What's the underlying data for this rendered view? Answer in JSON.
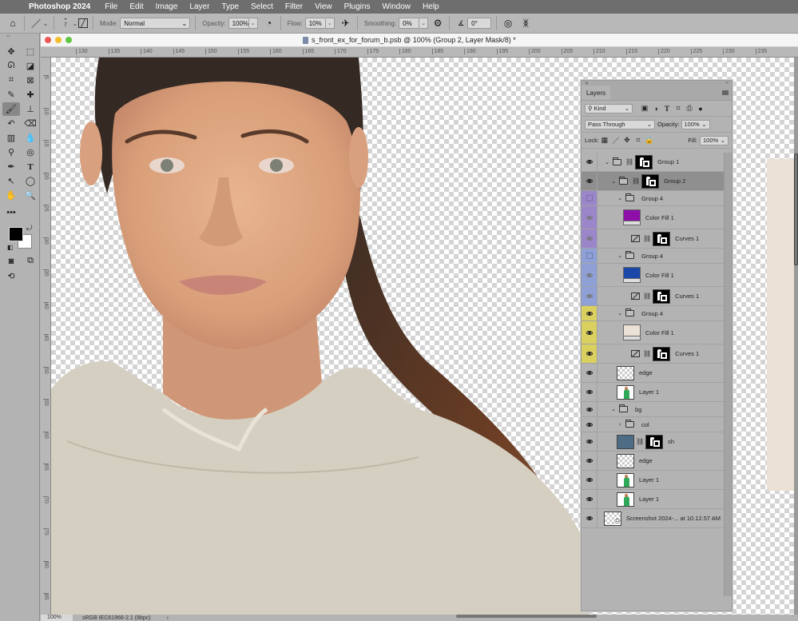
{
  "menubar": {
    "app_name": "Photoshop 2024",
    "items": [
      "File",
      "Edit",
      "Image",
      "Layer",
      "Type",
      "Select",
      "Filter",
      "View",
      "Plugins",
      "Window",
      "Help"
    ]
  },
  "options_bar": {
    "brush_size": "7",
    "mode_label": "Mode:",
    "mode_value": "Normal",
    "opacity_label": "Opacity:",
    "opacity_value": "100%",
    "flow_label": "Flow:",
    "flow_value": "10%",
    "smoothing_label": "Smoothing:",
    "smoothing_value": "0%",
    "angle_value": "0°"
  },
  "document": {
    "title": "s_front_ex_for_forum_b.psb @ 100% (Group 2, Layer Mask/8) *",
    "zoom": "100%",
    "color_profile": "sRGB IEC61966-2.1 (8bpc)",
    "status_arrow": "›",
    "ruler_h": [
      "130",
      "135",
      "140",
      "145",
      "150",
      "155",
      "160",
      "165",
      "170",
      "175",
      "180",
      "185",
      "190",
      "195",
      "200",
      "205",
      "210",
      "215",
      "220",
      "225",
      "230",
      "235"
    ],
    "ruler_v": [
      "5",
      "10",
      "15",
      "20",
      "25",
      "30",
      "35",
      "40",
      "45",
      "50",
      "55",
      "60",
      "65",
      "70",
      "75",
      "80",
      "85"
    ]
  },
  "layers_panel": {
    "title": "Layers",
    "filter_kind": "Kind",
    "blend_mode": "Pass Through",
    "opacity_label": "Opacity:",
    "opacity_value": "100%",
    "lock_label": "Lock:",
    "fill_label": "Fill:",
    "fill_value": "100%",
    "layers": [
      {
        "name": "Group 1",
        "type": "group",
        "indent": 0,
        "expanded": true,
        "visible": true,
        "color": "none",
        "selected": false,
        "mask": true
      },
      {
        "name": "Group 2",
        "type": "group",
        "indent": 1,
        "expanded": true,
        "visible": true,
        "color": "none",
        "selected": true,
        "mask": true
      },
      {
        "name": "Group 4",
        "type": "group",
        "indent": 2,
        "expanded": true,
        "visible": false,
        "color": "purple",
        "selected": false,
        "mask": false
      },
      {
        "name": "Color Fill 1",
        "type": "fill",
        "indent": 3,
        "visible": true,
        "color": "purple",
        "fill_color": "#8e0fa8"
      },
      {
        "name": "Curves 1",
        "type": "curves",
        "indent": 3,
        "visible": true,
        "color": "purple"
      },
      {
        "name": "Group 4",
        "type": "group",
        "indent": 2,
        "expanded": true,
        "visible": false,
        "color": "blue",
        "selected": false,
        "mask": false
      },
      {
        "name": "Color Fill 1",
        "type": "fill",
        "indent": 3,
        "visible": true,
        "color": "blue",
        "fill_color": "#1a47a8"
      },
      {
        "name": "Curves 1",
        "type": "curves",
        "indent": 3,
        "visible": true,
        "color": "blue"
      },
      {
        "name": "Group 4",
        "type": "group",
        "indent": 2,
        "expanded": true,
        "visible": true,
        "color": "yellow",
        "selected": false,
        "mask": false
      },
      {
        "name": "Color Fill 1",
        "type": "fill",
        "indent": 3,
        "visible": true,
        "color": "yellow",
        "fill_color": "#ebe2d5"
      },
      {
        "name": "Curves 1",
        "type": "curves",
        "indent": 3,
        "visible": true,
        "color": "yellow"
      },
      {
        "name": "edge",
        "type": "pixel-empty",
        "indent": 2,
        "visible": true,
        "color": "none"
      },
      {
        "name": "Layer 1",
        "type": "pixel-person",
        "indent": 2,
        "visible": true,
        "color": "none"
      },
      {
        "name": "bg",
        "type": "group",
        "indent": 1,
        "expanded": true,
        "visible": true,
        "color": "none",
        "mask": false
      },
      {
        "name": "col",
        "type": "group",
        "indent": 2,
        "expanded": false,
        "visible": true,
        "color": "none",
        "mask": false
      },
      {
        "name": "sh",
        "type": "fill-mask",
        "indent": 2,
        "visible": true,
        "color": "none",
        "fill_color": "#4e6c83"
      },
      {
        "name": "edge",
        "type": "pixel-empty",
        "indent": 2,
        "visible": true,
        "color": "none"
      },
      {
        "name": "Layer 1",
        "type": "pixel-person",
        "indent": 2,
        "visible": true,
        "color": "none"
      },
      {
        "name": "Layer 1",
        "type": "pixel-person",
        "indent": 2,
        "visible": true,
        "color": "none"
      },
      {
        "name": "Screenshot 2024-... at 10.12.57 AM",
        "type": "smart-object",
        "indent": 0,
        "visible": true,
        "color": "none"
      }
    ]
  },
  "tools": [
    {
      "name": "move-tool",
      "glyph": "✥"
    },
    {
      "name": "marquee-tool",
      "glyph": "⬚"
    },
    {
      "name": "lasso-tool",
      "glyph": "ᘏ"
    },
    {
      "name": "object-select-tool",
      "glyph": "◪"
    },
    {
      "name": "crop-tool",
      "glyph": "⌗"
    },
    {
      "name": "frame-tool",
      "glyph": "⊠"
    },
    {
      "name": "eyedropper-tool",
      "glyph": "✎"
    },
    {
      "name": "healing-brush-tool",
      "glyph": "✚"
    },
    {
      "name": "brush-tool",
      "glyph": "🖌"
    },
    {
      "name": "clone-stamp-tool",
      "glyph": "⊥"
    },
    {
      "name": "history-brush-tool",
      "glyph": "↶"
    },
    {
      "name": "eraser-tool",
      "glyph": "⌫"
    },
    {
      "name": "gradient-tool",
      "glyph": "▥"
    },
    {
      "name": "blur-tool",
      "glyph": "💧"
    },
    {
      "name": "dodge-tool",
      "glyph": "⚲"
    },
    {
      "name": "sponge-tool",
      "glyph": "◎"
    },
    {
      "name": "pen-tool",
      "glyph": "✒"
    },
    {
      "name": "type-tool",
      "glyph": "T"
    },
    {
      "name": "path-select-tool",
      "glyph": "↖"
    },
    {
      "name": "ellipse-tool",
      "glyph": "◯"
    },
    {
      "name": "hand-tool",
      "glyph": "✋"
    },
    {
      "name": "zoom-tool",
      "glyph": "🔍"
    }
  ],
  "colors": {
    "foreground": "#000000",
    "background": "#ffffff",
    "hoodie": "#d5cfc1",
    "bg_fill": "#ebe2d5"
  }
}
